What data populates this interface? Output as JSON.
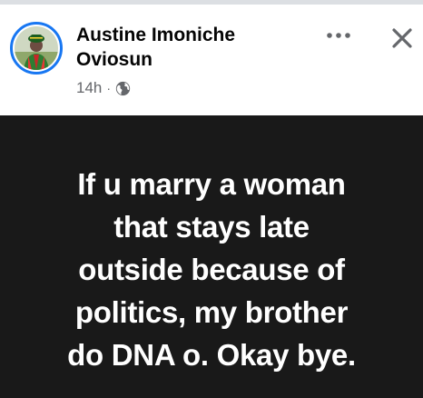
{
  "post": {
    "author_name": "Austine Imoniche Oviosun",
    "time_ago": "14h",
    "separator": "·",
    "audience_icon": "globe-icon",
    "more_icon": "more-options-icon",
    "close_icon": "close-icon",
    "body_text": "If u marry a woman\nthat stays late\noutside because of\npolitics, my brother\ndo  DNA o. Okay bye."
  },
  "colors": {
    "body_background": "#191919",
    "body_text": "#ffffff",
    "author_text": "#050505",
    "meta_text": "#65676b",
    "avatar_ring": "#1877f2"
  }
}
